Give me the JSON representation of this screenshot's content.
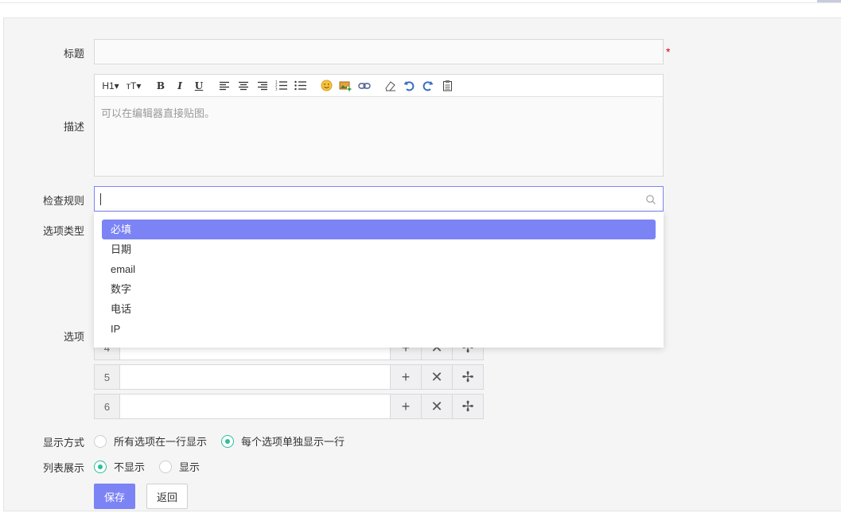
{
  "form": {
    "title_label": "标题",
    "required_mark": "*",
    "description_label": "描述",
    "editor_placeholder": "可以在编辑器直接贴图。",
    "check_rule_label": "检查规则",
    "option_type_label": "选项类型",
    "options_label": "选项",
    "display_mode_label": "显示方式",
    "list_display_label": "列表展示"
  },
  "toolbar": {
    "heading": "H1▾",
    "font_size": "ᴛT▾"
  },
  "dropdown": {
    "items": [
      "必填",
      "日期",
      "email",
      "数字",
      "电话",
      "IP"
    ],
    "highlighted_index": 0
  },
  "option_rows": [
    {
      "index": "4"
    },
    {
      "index": "5"
    },
    {
      "index": "6"
    }
  ],
  "row_buttons": {
    "add": "+",
    "remove": "✕",
    "move": "✢"
  },
  "display_mode": {
    "options": [
      "所有选项在一行显示",
      "每个选项单独显示一行"
    ],
    "selected": "每个选项单独显示一行"
  },
  "list_display": {
    "options": [
      "不显示",
      "显示"
    ],
    "selected": "不显示"
  },
  "actions": {
    "save": "保存",
    "back": "返回"
  },
  "colors": {
    "accent": "#7c84f5",
    "radio_on": "#2bbf9b",
    "required": "#d9001b"
  }
}
